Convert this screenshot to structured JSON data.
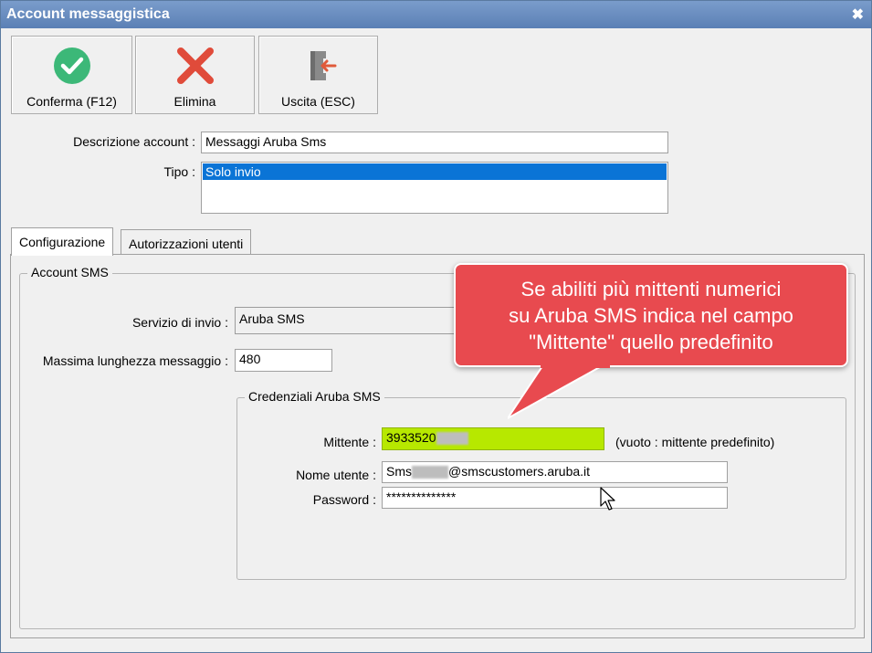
{
  "window": {
    "title": "Account messaggistica",
    "close_glyph": "✖"
  },
  "toolbar": {
    "confirm_label": "Conferma (F12)",
    "delete_label": "Elimina",
    "exit_label": "Uscita (ESC)"
  },
  "form": {
    "description_label": "Descrizione account :",
    "description_value": "Messaggi Aruba Sms",
    "type_label": "Tipo :",
    "type_selected": "Solo invio"
  },
  "tabs": [
    {
      "label": "Configurazione",
      "active": true
    },
    {
      "label": "Autorizzazioni utenti",
      "active": false
    }
  ],
  "sms_group": {
    "legend": "Account SMS",
    "service_label": "Servizio di invio :",
    "service_value": "Aruba SMS",
    "maxlen_label": "Massima lunghezza messaggio :",
    "maxlen_value": "480"
  },
  "credentials": {
    "legend": "Credenziali Aruba SMS",
    "sender_label": "Mittente :",
    "sender_value": "3933520",
    "sender_hint": "(vuoto : mittente predefinito)",
    "username_label": "Nome utente :",
    "username_prefix": "Sms",
    "username_suffix": "@smscustomers.aruba.it",
    "password_label": "Password :",
    "password_value": "**************"
  },
  "callout": {
    "line1": "Se abiliti più mittenti numerici",
    "line2": "su Aruba SMS indica nel campo",
    "line3": "\"Mittente\" quello predefinito"
  },
  "colors": {
    "callout": "#e84a4f",
    "highlight": "#b7e800",
    "selection": "#0a74d6"
  }
}
